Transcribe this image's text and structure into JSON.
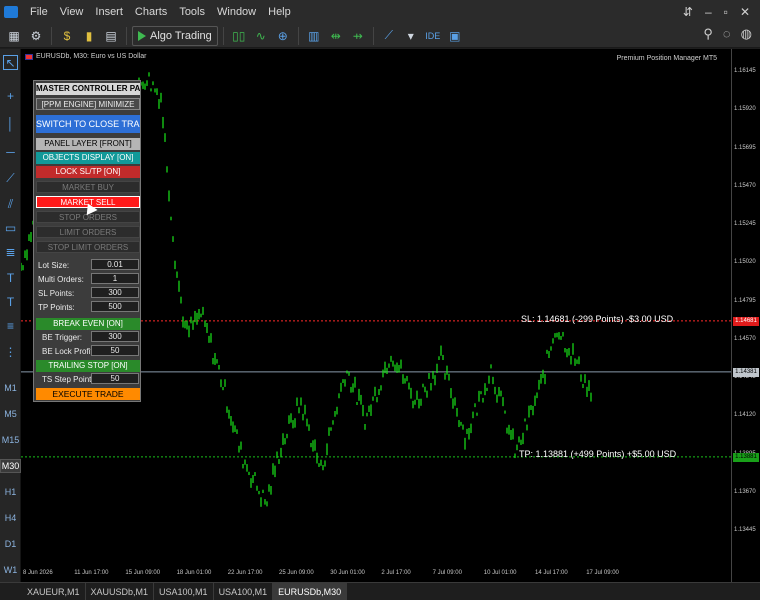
{
  "menu": {
    "items": [
      "File",
      "View",
      "Insert",
      "Charts",
      "Tools",
      "Window",
      "Help"
    ]
  },
  "toolbar": {
    "algo_label": "Algo Trading",
    "timeframe_dropdown": "",
    "ide_label": "IDE"
  },
  "chart": {
    "title": "EURUSDb, M30:  Euro vs US Dollar",
    "ea_name": "Premium Position Manager MT5",
    "sl_label": "SL: 1.14681 (-299 Points) -$3.00 USD",
    "tp_label": "TP: 1.13881 (+499 Points) +$5.00 USD",
    "price_labels": [
      "1.16145",
      "1.15920",
      "1.15695",
      "1.15470",
      "1.15245",
      "1.15020",
      "1.14795",
      "1.14570",
      "1.14345",
      "1.14120",
      "1.13895",
      "1.13670",
      "1.13445"
    ],
    "sl_tag": "1.14681",
    "cur_tag": "1.14381",
    "tp_tag": "1.13881",
    "time_labels": [
      "8 Jun 2026",
      "11 Jun 17:00",
      "15 Jun 09:00",
      "18 Jun 01:00",
      "22 Jun 17:00",
      "25 Jun 09:00",
      "30 Jun 01:00",
      "2 Jul 17:00",
      "7 Jul 09:00",
      "10 Jul 01:00",
      "14 Jul 17:00",
      "17 Jul 09:00"
    ],
    "colors": {
      "candle": "#19e619",
      "sl_line": "#ff2a2a",
      "tp_line": "#19c019",
      "current_line": "#8899aa"
    }
  },
  "timeframes": [
    "M1",
    "M5",
    "M15",
    "M30",
    "H1",
    "H4",
    "D1",
    "W1"
  ],
  "active_timeframe": "M30",
  "tabs": [
    "XAUEUR,M1",
    "XAUUSDb,M1",
    "USA100,M1",
    "USA100,M1",
    "EURUSDb,M30"
  ],
  "active_tab": "EURUSDb,M30",
  "panel": {
    "header": "MASTER CONTROLLER PANEL",
    "engine_label": "[PPM ENGINE]  MINIMIZE",
    "switch_label": "SWITCH TO CLOSE TRADES",
    "layer_label": "PANEL LAYER [FRONT]",
    "objects_label": "OBJECTS DISPLAY [ON]",
    "lock_label": "LOCK SL/TP [ON]",
    "market_buy": "MARKET BUY",
    "market_sell": "MARKET SELL",
    "stop_orders": "STOP ORDERS",
    "limit_orders": "LIMIT ORDERS",
    "stop_limit_orders": "STOP LIMIT ORDERS",
    "lot_size_label": "Lot Size:",
    "lot_size": "0.01",
    "multi_orders_label": "Multi Orders:",
    "multi_orders": "1",
    "sl_points_label": "SL Points:",
    "sl_points": "300",
    "tp_points_label": "TP Points:",
    "tp_points": "500",
    "break_even_label": "BREAK EVEN [ON]",
    "be_trigger_label": "BE Trigger:",
    "be_trigger": "300",
    "be_lock_label": "BE Lock Profit:",
    "be_lock": "50",
    "trailing_label": "TRAILING STOP [ON]",
    "ts_step_label": "TS Step Points:",
    "ts_step": "50",
    "execute_label": "EXECUTE TRADE"
  }
}
